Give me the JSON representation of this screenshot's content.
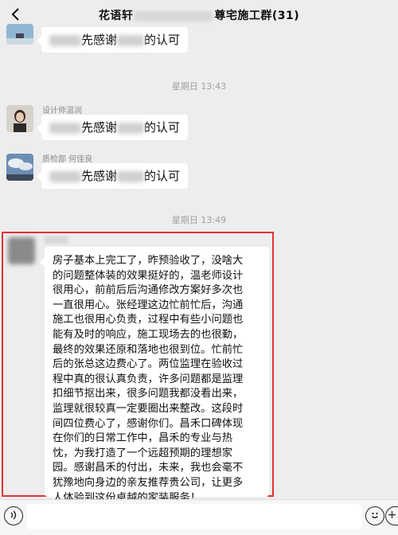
{
  "header": {
    "title_prefix": "花语轩",
    "title_suffix": "尊宅施工群(31)",
    "back_icon": "chevron-left-icon"
  },
  "messages": [
    {
      "sender": "",
      "text_prefix": "先感谢",
      "text_suffix": "的认可",
      "avatar_icon": "beach-avatar"
    },
    {
      "sender": "设计师温润",
      "text_prefix": "先感谢",
      "text_suffix": "的认可",
      "avatar_icon": "portrait-avatar"
    },
    {
      "sender": "质检部 何佳良",
      "text_prefix": "先感谢",
      "text_suffix": "的认可",
      "avatar_icon": "cloud-sky-avatar"
    }
  ],
  "timestamps": [
    "星期日 13:43",
    "星期日 13:49"
  ],
  "review": {
    "text": "房子基本上完工了，昨预验收了，没啥大\n的问题整体装的效果挺好的，温老师设计\n很用心，前前后后沟通修改方案好多次也\n一直很用心。张经理这边忙前忙后，沟通\n施工也很用心负责，过程中有些小问题也\n能有及时的响应，施工现场去的也很勤，\n最终的效果还原和落地也很到位。忙前忙\n后的张总这边费心了。两位监理在验收过\n程中真的很认真负责，许多问题都是监理\n扣细节抠出来，很多问题我都没看出来，\n监理就很较真一定要圈出来整改。这段时\n间四位费心了，感谢你们。昌禾口碑体现\n在你们的日常工作中，昌禾的专业与热\n忱，为我打造了一个远超预期的理想家\n园。感谢昌禾的付出，未来，我也会毫不\n犹豫地向身边的亲友推荐贵公司，让更多\n人体验到这份卓越的家装服务！"
  },
  "bottom_bar": {
    "voice_icon": "voice-icon",
    "emoji_icon": "emoji-icon",
    "add_icon": "plus-icon",
    "add_label": "+"
  }
}
